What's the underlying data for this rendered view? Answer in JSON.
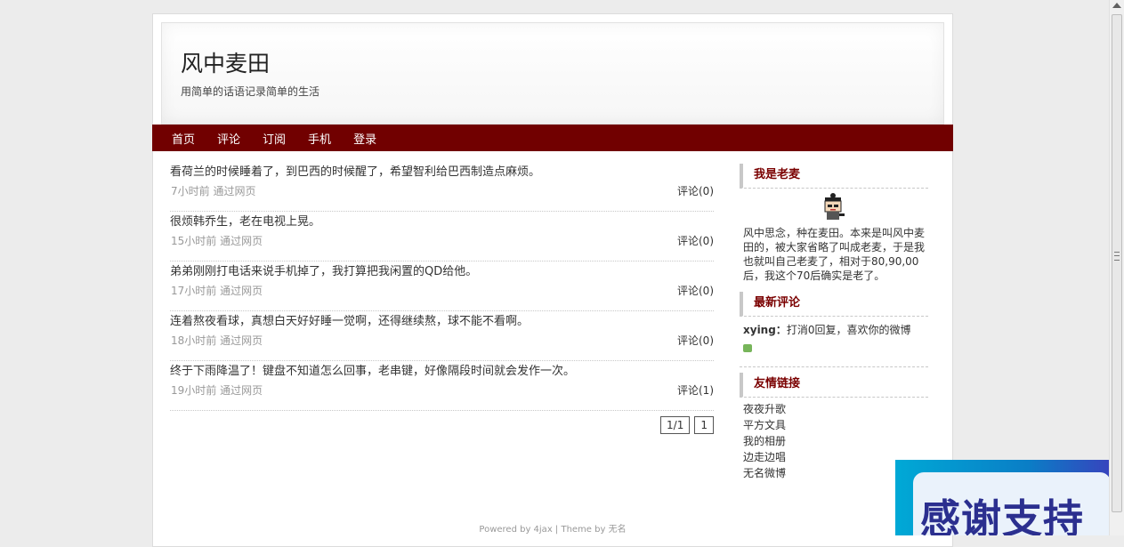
{
  "site": {
    "title": "风中麦田",
    "subtitle": "用简单的话语记录简单的生活"
  },
  "nav": {
    "items": [
      "首页",
      "评论",
      "订阅",
      "手机",
      "登录"
    ]
  },
  "posts": [
    {
      "text": "看荷兰的时候睡着了，到巴西的时候醒了，希望智利给巴西制造点麻烦。",
      "meta": "7小时前 通过网页",
      "comments": "评论(0)"
    },
    {
      "text": "很烦韩乔生，老在电视上晃。",
      "meta": "15小时前 通过网页",
      "comments": "评论(0)"
    },
    {
      "text": "弟弟刚刚打电话来说手机掉了，我打算把我闲置的QD给他。",
      "meta": "17小时前 通过网页",
      "comments": "评论(0)"
    },
    {
      "text": "连着熬夜看球，真想白天好好睡一觉啊，还得继续熬，球不能不看啊。",
      "meta": "18小时前 通过网页",
      "comments": "评论(0)"
    },
    {
      "text": "终于下雨降温了！键盘不知道怎么回事，老串键，好像隔段时间就会发作一次。",
      "meta": "19小时前 通过网页",
      "comments": "评论(1)"
    }
  ],
  "pager": {
    "summary": "1/1",
    "page": "1"
  },
  "sidebar": {
    "about_title": "我是老麦",
    "about_text": "风中思念，种在麦田。本来是叫风中麦田的，被大家省略了叫成老麦，于是我也就叫自己老麦了，相对于80,90,00后，我这个70后确实是老了。",
    "comments_title": "最新评论",
    "latest_comment": {
      "author": "xying：",
      "text": "打消0回复，喜欢你的微博"
    },
    "links_title": "友情链接",
    "links": [
      "夜夜升歌",
      "平方文具",
      "我的相册",
      "边走边唱",
      "无名微博"
    ]
  },
  "footer": {
    "text": "Powered by 4jax | Theme by 无名"
  },
  "promo": {
    "text": "感谢支持"
  },
  "colors": {
    "nav_bg": "#710000",
    "widget_title": "#7a0000"
  }
}
